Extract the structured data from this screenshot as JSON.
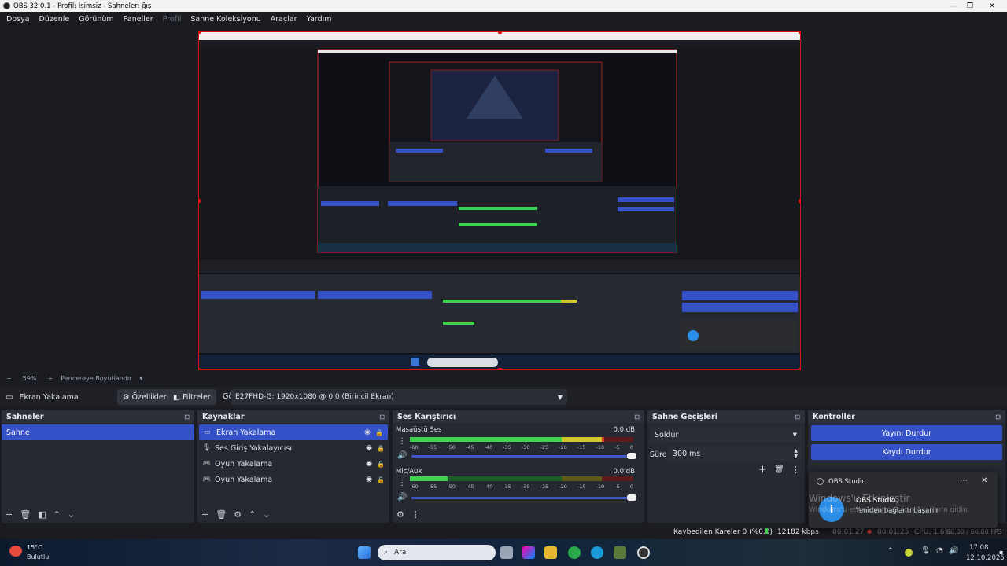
{
  "window": {
    "title": "OBS 32.0.1 - Profil: İsimsiz - Sahneler: ğış"
  },
  "menu": [
    "Dosya",
    "Düzenle",
    "Görünüm",
    "Paneller",
    "Profil",
    "Sahne Koleksiyonu",
    "Araçlar",
    "Yardım"
  ],
  "preview": {
    "zoom": "59%",
    "fit_label": "Pencereye Boyutlandır"
  },
  "source_bar": {
    "source_name": "Ekran Yakalama",
    "properties_label": "Özellikler",
    "filters_label": "Filtreler",
    "display_label": "Görüntü",
    "display_value": "E27FHD-G: 1920x1080 @ 0,0 (Birincil Ekran)"
  },
  "scenes": {
    "title": "Sahneler",
    "items": [
      "Sahne"
    ]
  },
  "sources": {
    "title": "Kaynaklar",
    "items": [
      {
        "label": "Ekran Yakalama",
        "icon": "monitor-icon"
      },
      {
        "label": "Ses Giriş Yakalayıcısı",
        "icon": "microphone-icon"
      },
      {
        "label": "Oyun Yakalama",
        "icon": "gamepad-icon"
      },
      {
        "label": "Oyun Yakalama",
        "icon": "gamepad-icon"
      }
    ]
  },
  "mixer": {
    "title": "Ses Karıştırıcı",
    "ticks": [
      "-60",
      "-55",
      "-50",
      "-45",
      "-40",
      "-35",
      "-30",
      "-25",
      "-20",
      "-15",
      "-10",
      "-5",
      "0"
    ],
    "channels": [
      {
        "name": "Masaüstü Ses",
        "db": "0.0 dB",
        "level": 0.87
      },
      {
        "name": "Mic/Aux",
        "db": "0.0 dB",
        "level": 0.17
      }
    ]
  },
  "transitions": {
    "title": "Sahne Geçişleri",
    "type": "Soldur",
    "duration_label": "Süre",
    "duration_value": "300 ms"
  },
  "controls": {
    "title": "Kontroller",
    "stop_stream": "Yayını Durdur",
    "stop_record": "Kaydı Durdur"
  },
  "status": {
    "dropped": "Kaybedilen Kareler 0 (%0.0)",
    "kbps": "12182 kbps",
    "live": "00:01:27",
    "rec": "00:01:25",
    "cpu": "CPU: 1.6%",
    "fps": "60.00 / 60.00 FPS"
  },
  "notification": {
    "app": "OBS Studio",
    "title": "OBS Studio",
    "body": "Yeniden bağlantı başarılı",
    "watermark1": "Windows'u Etkinleştir",
    "watermark2": "Windows'u etkinleştirmek için Ayarlar'a gidin."
  },
  "taskbar": {
    "temp": "15°C",
    "weather": "Bulutlu",
    "search": "Ara",
    "time": "17:08",
    "date": "12.10.2025"
  },
  "colors": {
    "accent": "#3451c8",
    "selection": "#d11111"
  }
}
